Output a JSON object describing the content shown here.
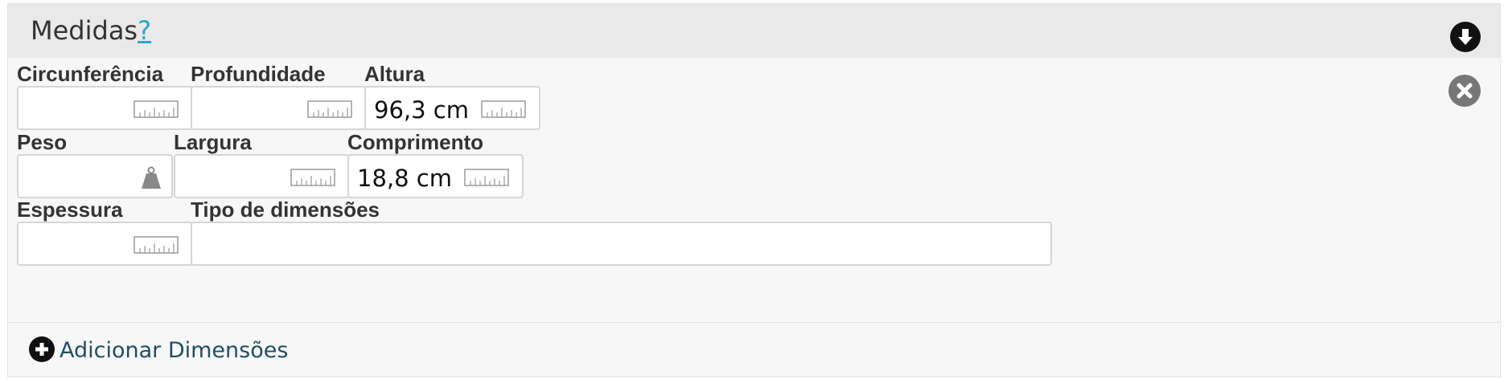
{
  "section": {
    "title": "Medidas",
    "help_label": "?",
    "collapse_icon": "arrow-down-circle-icon",
    "remove_icon": "close-circle-icon"
  },
  "fields": {
    "circunferencia": {
      "label": "Circunferência",
      "value": "",
      "icon": "ruler-icon"
    },
    "profundidade": {
      "label": "Profundidade",
      "value": "",
      "icon": "ruler-icon"
    },
    "altura": {
      "label": "Altura",
      "value": "96,3 cm",
      "icon": "ruler-icon"
    },
    "peso": {
      "label": "Peso",
      "value": "",
      "icon": "weight-icon"
    },
    "largura": {
      "label": "Largura",
      "value": "",
      "icon": "ruler-icon"
    },
    "comprimento": {
      "label": "Comprimento",
      "value": "18,8 cm",
      "icon": "ruler-icon"
    },
    "espessura": {
      "label": "Espessura",
      "value": "",
      "icon": "ruler-icon"
    },
    "tipo_dimensoes": {
      "label": "Tipo de dimensões",
      "value": ""
    }
  },
  "footer": {
    "add_label": "Adicionar Dimensões",
    "add_icon": "plus-circle-icon"
  },
  "colors": {
    "help_link": "#2aa7c9",
    "add_link": "#1e4f63",
    "header_bg": "#e9e9e9",
    "panel_bg": "#f7f7f7"
  }
}
